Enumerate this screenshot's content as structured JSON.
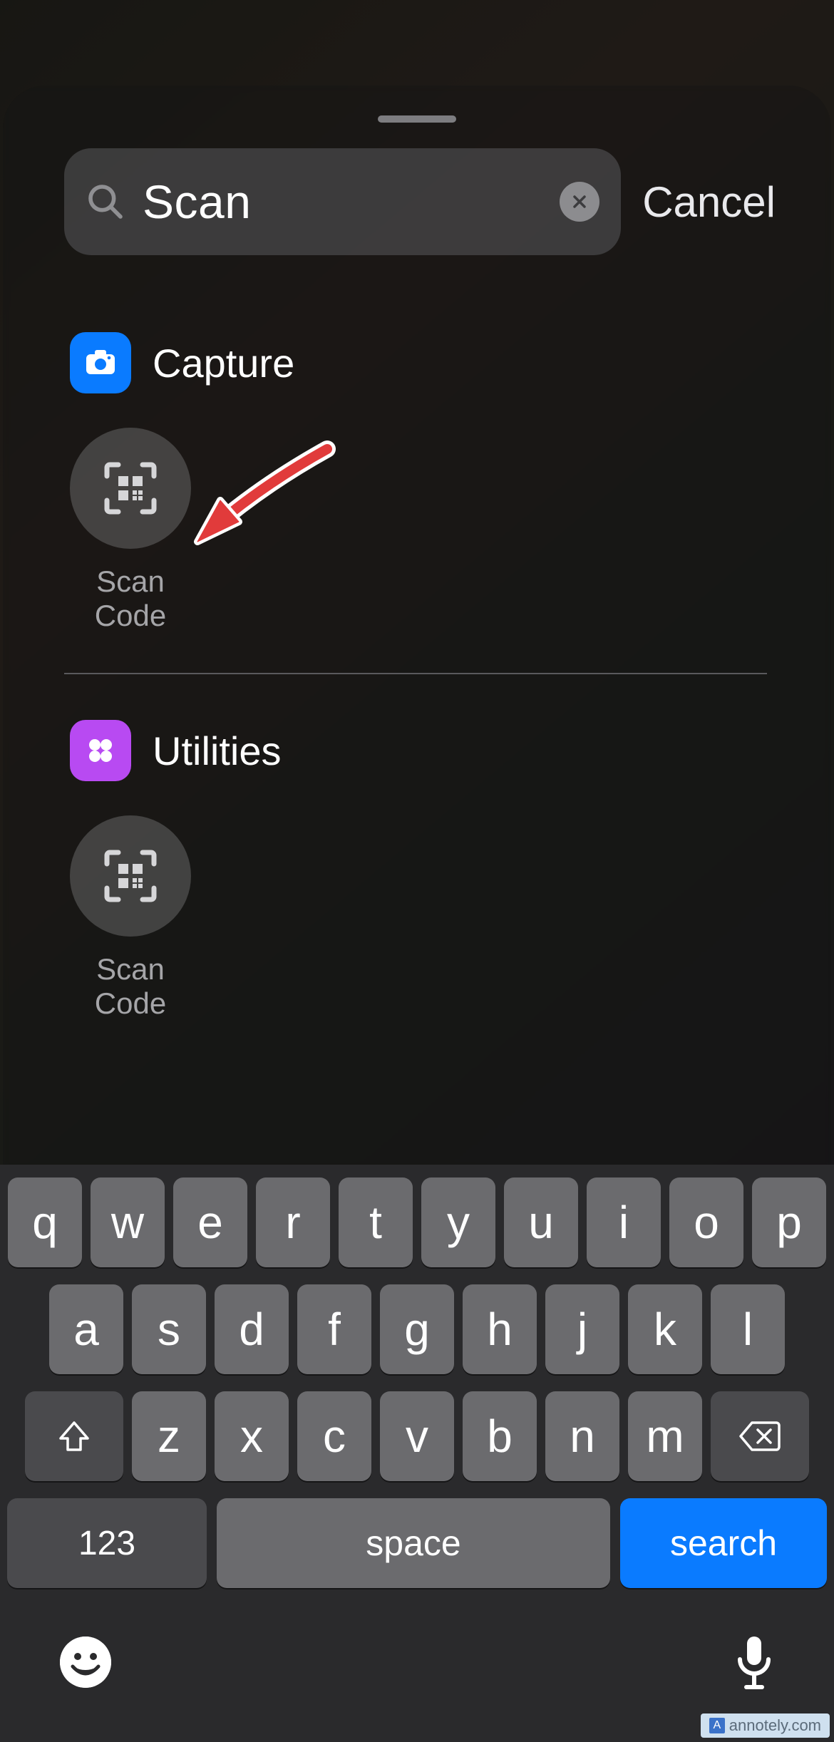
{
  "search": {
    "query": "Scan",
    "cancel_label": "Cancel"
  },
  "sections": [
    {
      "title": "Capture",
      "folder_color": "blue",
      "apps": [
        {
          "label": "Scan Code"
        }
      ]
    },
    {
      "title": "Utilities",
      "folder_color": "purple",
      "apps": [
        {
          "label": "Scan Code"
        }
      ]
    }
  ],
  "keyboard": {
    "row1": [
      "q",
      "w",
      "e",
      "r",
      "t",
      "y",
      "u",
      "i",
      "o",
      "p"
    ],
    "row2": [
      "a",
      "s",
      "d",
      "f",
      "g",
      "h",
      "j",
      "k",
      "l"
    ],
    "row3": [
      "z",
      "x",
      "c",
      "v",
      "b",
      "n",
      "m"
    ],
    "numeric_label": "123",
    "space_label": "space",
    "action_label": "search"
  },
  "watermark": "annotely.com"
}
